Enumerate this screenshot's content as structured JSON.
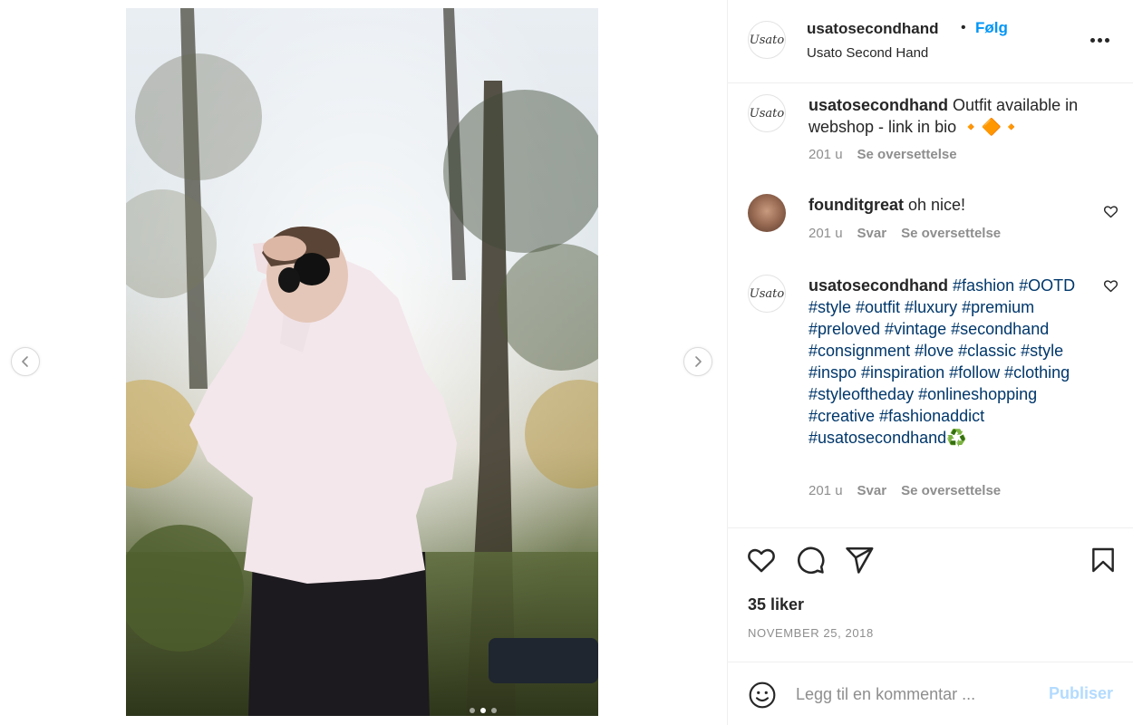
{
  "post": {
    "username": "usatosecondhand",
    "separator": "•",
    "follow_label": "Følg",
    "subtitle": "Usato Second Hand",
    "avatar_logo": "Usato"
  },
  "media": {
    "image_description": "Woman in white blouse and sunglasses standing among trees",
    "carousel_count": 3,
    "carousel_active_index": 1
  },
  "comments": [
    {
      "username": "usatosecondhand",
      "text": "Outfit available in webshop - link in bio",
      "emoji": "🔸🔶🔸",
      "time": "201 u",
      "actions": [
        "Se oversettelse"
      ]
    },
    {
      "username": "founditgreat",
      "text": "oh nice!",
      "time": "201 u",
      "actions": [
        "Svar",
        "Se oversettelse"
      ]
    },
    {
      "username": "usatosecondhand",
      "hashtags": "#fashion #OOTD #style #outfit #luxury #premium #preloved #vintage #secondhand #consignment #love #classic #style #inspo #inspiration #follow #clothing #styleoftheday #onlineshopping #creative #fashionaddict #usatosecondhand♻️",
      "time": "201 u",
      "actions": [
        "Svar",
        "Se oversettelse"
      ]
    }
  ],
  "engagement": {
    "likes": "35 liker",
    "date": "NOVEMBER 25, 2018"
  },
  "comment_box": {
    "placeholder": "Legg til en kommentar ...",
    "publish_label": "Publiser"
  },
  "colors": {
    "follow_blue": "#0095f6",
    "hashtag_blue": "#00376b",
    "muted_gray": "#8e8e8e",
    "publish_disabled": "#b3dbff"
  },
  "icons": [
    "chevron-left-icon",
    "chevron-right-icon",
    "more-icon",
    "heart-icon",
    "comment-icon",
    "share-icon",
    "bookmark-icon",
    "emoji-icon"
  ]
}
